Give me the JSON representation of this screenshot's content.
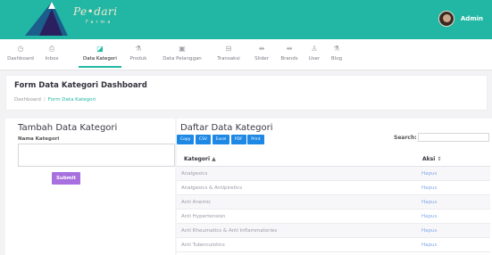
{
  "brand": {
    "name": "Pe•dari",
    "tagline": "Farma"
  },
  "user": {
    "name": "Admin"
  },
  "nav": [
    {
      "label": "Dashboard",
      "icon": "clock-icon",
      "glyph": "◷"
    },
    {
      "label": "Inbox",
      "icon": "inbox-icon",
      "glyph": "⎙"
    },
    {
      "label": "Data Kategori",
      "icon": "edit-icon",
      "glyph": "◪"
    },
    {
      "label": "Produk",
      "icon": "flask-icon",
      "glyph": "⚗"
    },
    {
      "label": "Data Pelanggan",
      "icon": "contact-icon",
      "glyph": "▣"
    },
    {
      "label": "Transaksi",
      "icon": "cart-icon",
      "glyph": "⊟"
    },
    {
      "label": "Slider",
      "icon": "slider-icon",
      "glyph": "⇹"
    },
    {
      "label": "Brands",
      "icon": "brands-icon",
      "glyph": "⇹"
    },
    {
      "label": "User",
      "icon": "user-icon",
      "glyph": "♙"
    },
    {
      "label": "Blog",
      "icon": "blog-icon",
      "glyph": "⚗"
    }
  ],
  "header": {
    "title": "Form Data Kategori Dashboard",
    "breadcrumb": [
      "Dashboard",
      "/",
      "Form Data Kategori"
    ]
  },
  "form": {
    "title": "Tambah Data Kategori",
    "field_label": "Nama Kategori",
    "field_value": "",
    "submit_label": "Submit"
  },
  "list": {
    "title": "Daftar Data Kategori",
    "exports": [
      "Copy",
      "CSV",
      "Excel",
      "PDF",
      "Print"
    ],
    "search_label": "Search:",
    "search_value": "",
    "columns": [
      "Kategori",
      "Aksi"
    ],
    "sort_glyph_asc": "▲",
    "sort_glyph_both": "⇕",
    "rows": [
      {
        "kategori": "Analgesics",
        "aksi": "Hapus"
      },
      {
        "kategori": "Analgesics & Antipiretics",
        "aksi": "Hapus"
      },
      {
        "kategori": "Anti Anemic",
        "aksi": "Hapus"
      },
      {
        "kategori": "Anti Hypertension",
        "aksi": "Hapus"
      },
      {
        "kategori": "Anti Rheumatics & Anti Inflammatories",
        "aksi": "Hapus"
      },
      {
        "kategori": "Anti Tuberculotics",
        "aksi": "Hapus"
      }
    ]
  },
  "colors": {
    "accent": "#22b7a4",
    "button": "#1e88e5",
    "submit": "#a86fdf",
    "link": "#7fa8e6"
  }
}
